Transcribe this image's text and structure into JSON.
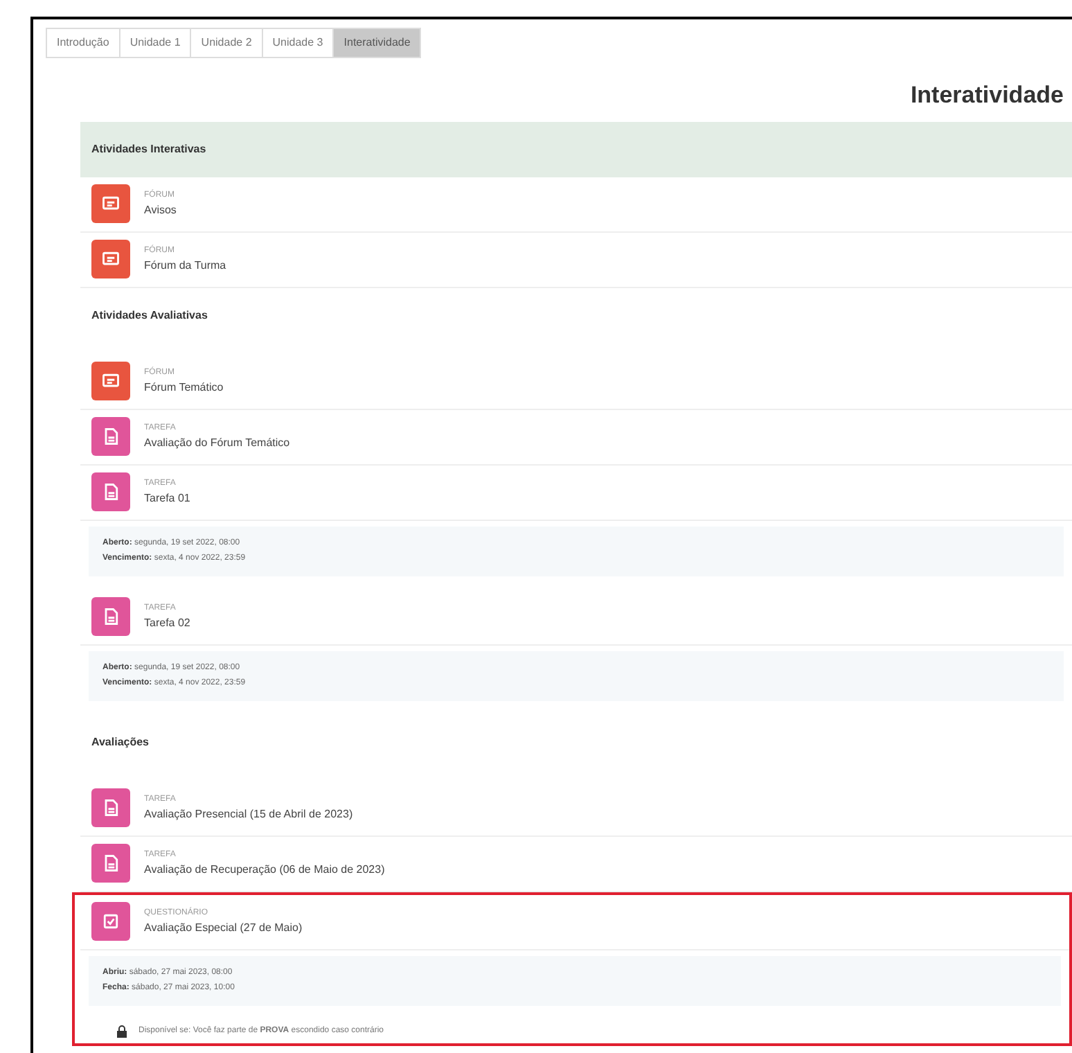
{
  "tabs": [
    {
      "label": "Introdução",
      "selected": false
    },
    {
      "label": "Unidade 1",
      "selected": false
    },
    {
      "label": "Unidade 2",
      "selected": false
    },
    {
      "label": "Unidade 3",
      "selected": false
    },
    {
      "label": "Interatividade",
      "selected": true
    }
  ],
  "page_title": "Interatividade",
  "sections": [
    {
      "title": "Atividades Interativas",
      "shaded": true,
      "items": [
        {
          "kind": "forum",
          "type_label": "FÓRUM",
          "name": "Avisos",
          "highlighted": false
        },
        {
          "kind": "forum",
          "type_label": "FÓRUM",
          "name": "Fórum da Turma",
          "highlighted": false
        }
      ]
    },
    {
      "title": "Atividades Avaliativas",
      "shaded": false,
      "items": [
        {
          "kind": "forum",
          "type_label": "FÓRUM",
          "name": "Fórum Temático",
          "highlighted": false
        },
        {
          "kind": "assign",
          "type_label": "TAREFA",
          "name": "Avaliação do Fórum Temático",
          "highlighted": false
        },
        {
          "kind": "assign",
          "type_label": "TAREFA",
          "name": "Tarefa 01",
          "highlighted": false,
          "dates": [
            {
              "label": "Aberto:",
              "value": "segunda, 19 set 2022, 08:00"
            },
            {
              "label": "Vencimento:",
              "value": "sexta, 4 nov 2022, 23:59"
            }
          ]
        },
        {
          "kind": "assign",
          "type_label": "TAREFA",
          "name": "Tarefa 02",
          "highlighted": false,
          "dates": [
            {
              "label": "Aberto:",
              "value": "segunda, 19 set 2022, 08:00"
            },
            {
              "label": "Vencimento:",
              "value": "sexta, 4 nov 2022, 23:59"
            }
          ]
        }
      ]
    },
    {
      "title": "Avaliações",
      "shaded": false,
      "items": [
        {
          "kind": "assign",
          "type_label": "TAREFA",
          "name": "Avaliação Presencial (15 de Abril de 2023)",
          "highlighted": false
        },
        {
          "kind": "assign",
          "type_label": "TAREFA",
          "name": "Avaliação de Recuperação (06 de Maio de 2023)",
          "highlighted": false
        },
        {
          "kind": "quiz",
          "type_label": "QUESTIONÁRIO",
          "name": "Avaliação Especial (27 de Maio)",
          "highlighted": true,
          "dates": [
            {
              "label": "Abriu:",
              "value": "sábado, 27 mai 2023, 08:00"
            },
            {
              "label": "Fecha:",
              "value": "sábado, 27 mai 2023, 10:00"
            }
          ],
          "restriction": "Disponível se: Você faz parte de **PROVA** escondido caso contrário"
        }
      ]
    }
  ]
}
